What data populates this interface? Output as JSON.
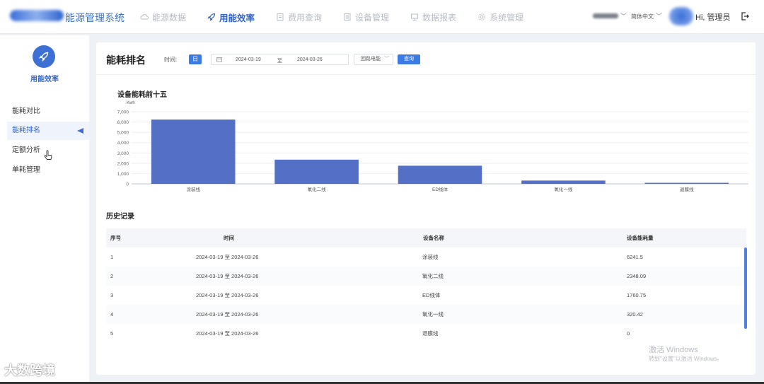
{
  "app": {
    "title": "能源管理系统"
  },
  "nav": [
    {
      "label": "能源数据",
      "icon": "cloud-icon"
    },
    {
      "label": "用能效率",
      "icon": "rocket-icon",
      "active": true
    },
    {
      "label": "费用查询",
      "icon": "document-icon"
    },
    {
      "label": "设备管理",
      "icon": "device-icon"
    },
    {
      "label": "数据报表",
      "icon": "report-icon"
    },
    {
      "label": "系统管理",
      "icon": "gear-icon"
    }
  ],
  "header": {
    "language": "简体中文",
    "greeting": "Hi, 管理员"
  },
  "sidebar": {
    "title": "用能效率",
    "items": [
      {
        "label": "能耗对比"
      },
      {
        "label": "能耗排名",
        "active": true
      },
      {
        "label": "定额分析"
      },
      {
        "label": "单耗管理"
      }
    ]
  },
  "page": {
    "title": "能耗排名",
    "time_label": "时间:",
    "day_button": "日",
    "date_start": "2024-03-19",
    "date_sep": "至",
    "date_end": "2024-03-26",
    "device_select": "回路电能",
    "query_button": "查询"
  },
  "chart_data": {
    "type": "bar",
    "title": "设备能耗前十五",
    "ylabel": "Kwh",
    "categories": [
      "涂装线",
      "氧化二线",
      "ED线体",
      "氧化一线",
      "退膜线"
    ],
    "values": [
      6241.5,
      2348.09,
      1760.75,
      320.42,
      0
    ],
    "ylim": [
      0,
      7000
    ],
    "yticks": [
      "0",
      "1,000",
      "2,000",
      "3,000",
      "4,000",
      "5,000",
      "6,000",
      "7,000"
    ],
    "color": "#5470c6",
    "grid": true
  },
  "history": {
    "title": "历史记录",
    "columns": [
      "序号",
      "时间",
      "设备名称",
      "设备能耗量"
    ],
    "rows": [
      [
        "1",
        "2024-03-19 至 2024-03-26",
        "涂装线",
        "6241.5"
      ],
      [
        "2",
        "2024-03-19 至 2024-03-26",
        "氧化二线",
        "2348.09"
      ],
      [
        "3",
        "2024-03-19 至 2024-03-26",
        "ED线体",
        "1760.75"
      ],
      [
        "4",
        "2024-03-19 至 2024-03-26",
        "氧化一线",
        "320.42"
      ],
      [
        "5",
        "2024-03-19 至 2024-03-26",
        "退膜线",
        "0"
      ]
    ]
  },
  "watermarks": {
    "windows_line1": "激活 Windows",
    "windows_line2": "转到\"设置\"以激活 Windows。",
    "brand": "大数跨境"
  }
}
